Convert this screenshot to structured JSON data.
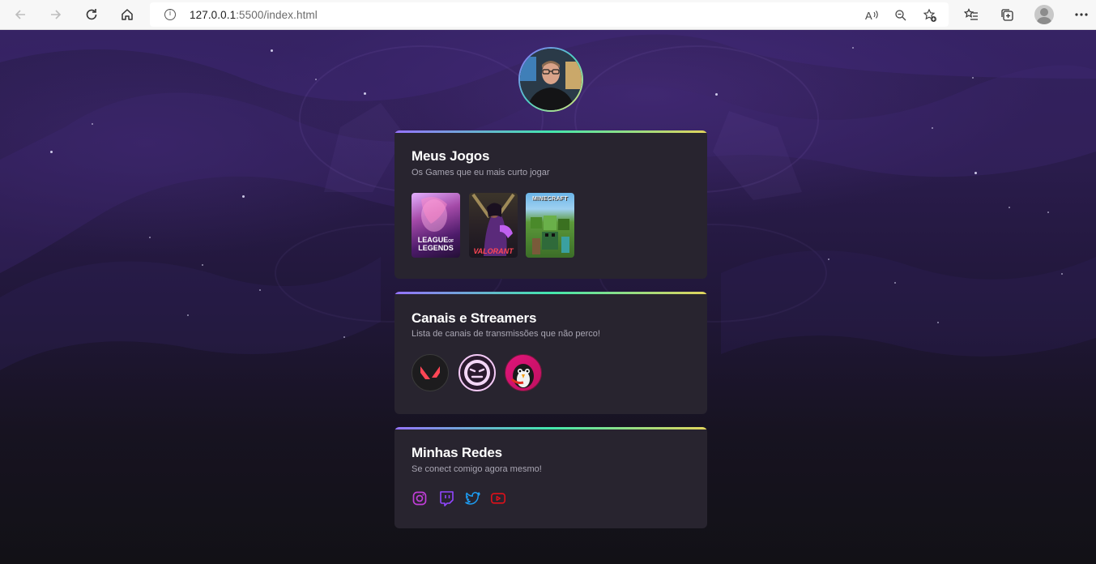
{
  "browser": {
    "url_host": "127.0.0.1",
    "url_path": ":5500/index.html"
  },
  "cards": [
    {
      "title": "Meus Jogos",
      "subtitle": "Os Games que eu mais curto jogar",
      "games": [
        {
          "name": "League of Legends",
          "label_line1": "LEAGUE",
          "label_line2": "LEGENDS",
          "label_of": "OF"
        },
        {
          "name": "Valorant",
          "label": "VALORANT"
        },
        {
          "name": "Minecraft",
          "label": "MINECRAFT"
        }
      ]
    },
    {
      "title": "Canais e Streamers",
      "subtitle": "Lista de canais de transmissões que não perco!",
      "channels": [
        {
          "name": "valorant-channel"
        },
        {
          "name": "face-channel"
        },
        {
          "name": "penguin-channel"
        }
      ]
    },
    {
      "title": "Minhas Redes",
      "subtitle": "Se conect comigo agora mesmo!",
      "socials": [
        {
          "name": "instagram",
          "color": "#c13ed8"
        },
        {
          "name": "twitch",
          "color": "#9146ff"
        },
        {
          "name": "twitter",
          "color": "#1d9bf0"
        },
        {
          "name": "youtube",
          "color": "#e0101a"
        }
      ]
    }
  ],
  "theme": {
    "accent_gradient": [
      "#9572fc",
      "#43e7ad",
      "#e2d45c"
    ],
    "card_bg": "#28242f"
  }
}
